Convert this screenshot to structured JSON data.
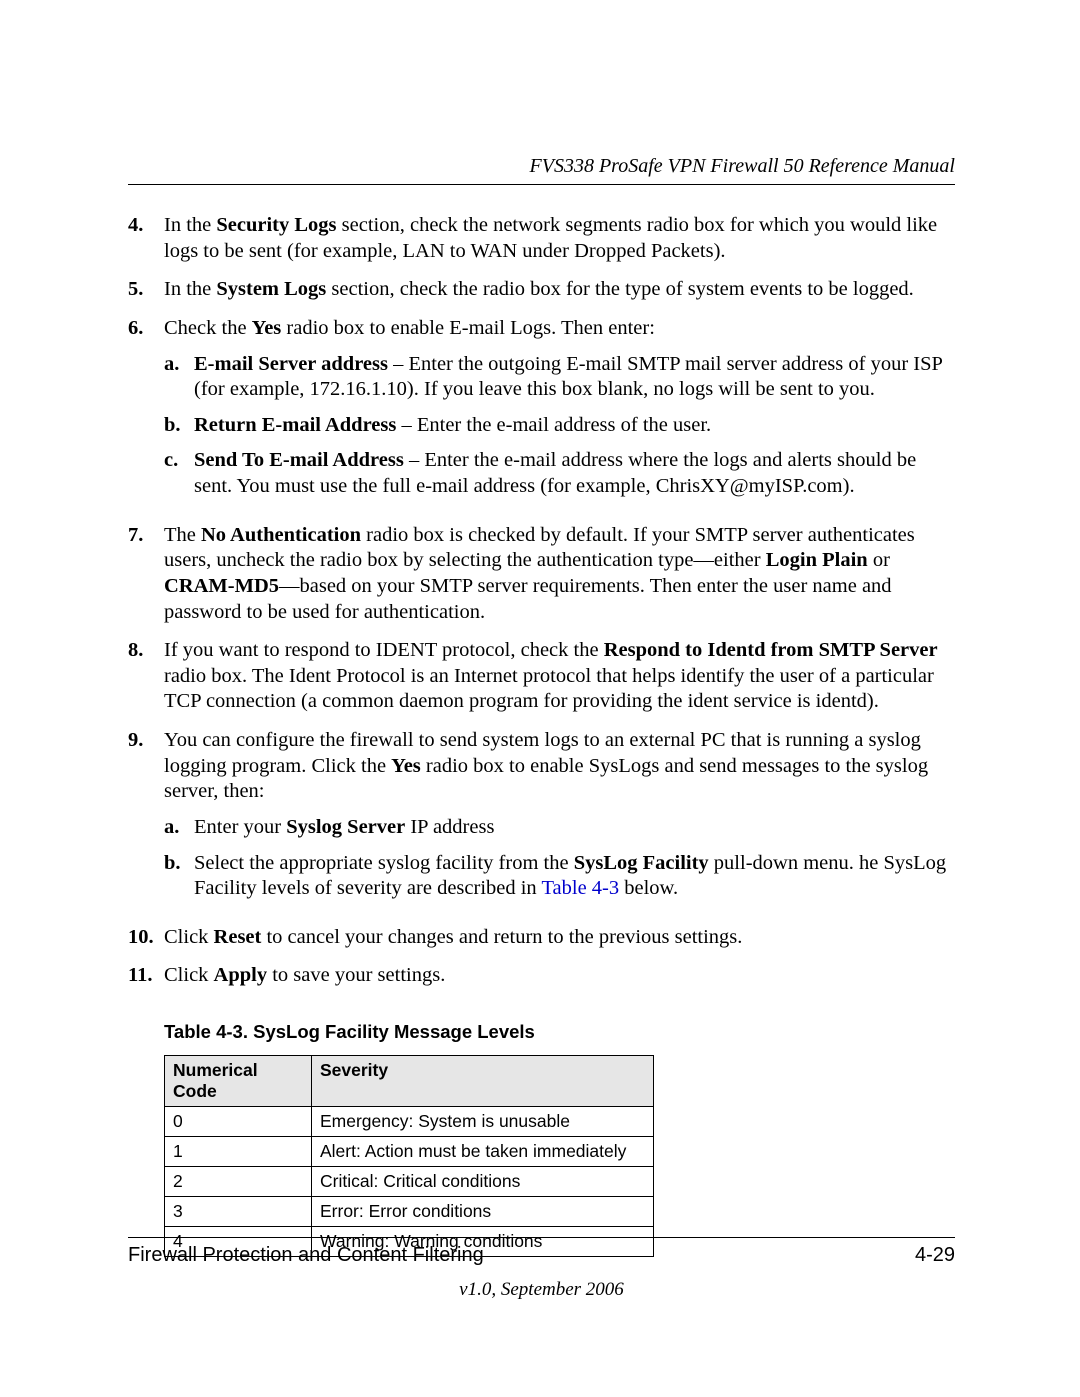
{
  "header": {
    "title": "FVS338 ProSafe VPN Firewall 50 Reference Manual"
  },
  "list": {
    "item4": {
      "num": "4.",
      "pre": "In the ",
      "bold": "Security Logs",
      "post": " section, check the network segments radio box for which you would like logs to be sent (for example, LAN to WAN under Dropped Packets)."
    },
    "item5": {
      "num": "5.",
      "pre": "In the ",
      "bold": "System Logs",
      "post": " section, check the radio box for the type of system events to be logged."
    },
    "item6": {
      "num": "6.",
      "pre": "Check the ",
      "bold": "Yes",
      "post": " radio box to enable E-mail Logs. Then enter:",
      "a": {
        "letter": "a.",
        "bold": "E-mail Server address",
        "text": " – Enter the outgoing E-mail SMTP mail server address of your ISP (for example, 172.16.1.10). If you leave this box blank, no logs will be sent to you."
      },
      "b": {
        "letter": "b.",
        "bold": "Return E-mail Address",
        "text": " – Enter the e-mail address of the user."
      },
      "c": {
        "letter": "c.",
        "bold": "Send To E-mail Address",
        "text": " – Enter the e-mail address where the logs and alerts should be sent. You must use the full e-mail address (for example, ChrisXY@myISP.com)."
      }
    },
    "item7": {
      "num": "7.",
      "t1": "The ",
      "b1": "No Authentication",
      "t2": " radio box is checked by default. If your SMTP server authenticates users, uncheck the radio box by selecting the authentication type—either ",
      "b2": "Login Plain",
      "t3": " or ",
      "b3": "CRAM-MD5",
      "t4": "—based on your SMTP server requirements. Then enter the user name and password to be used for authentication."
    },
    "item8": {
      "num": "8.",
      "t1": "If you want to respond to IDENT protocol, check the ",
      "b1": "Respond to Identd from SMTP Server",
      "t2": " radio box. The Ident Protocol is an Internet protocol that helps identify the user of a particular TCP connection (a common daemon program for providing the ident service is identd)."
    },
    "item9": {
      "num": "9.",
      "t1": "You can configure the firewall to send system logs to an external PC that is running a syslog logging program. Click the ",
      "b1": "Yes",
      "t2": " radio box to enable SysLogs and send messages to the syslog server, then:",
      "a": {
        "letter": "a.",
        "t1": "Enter your ",
        "b1": "Syslog Server",
        "t2": " IP address"
      },
      "b": {
        "letter": "b.",
        "t1": "Select the appropriate syslog facility from the ",
        "b1": "SysLog Facility",
        "t2": " pull-down menu. he SysLog Facility levels of severity are described in ",
        "link": "Table 4-3",
        "t3": " below."
      }
    },
    "item10": {
      "num": "10.",
      "t1": "Click ",
      "b1": "Reset",
      "t2": " to cancel your changes and return to the previous settings."
    },
    "item11": {
      "num": "11.",
      "t1": "Click ",
      "b1": "Apply",
      "t2": " to save your settings."
    }
  },
  "table": {
    "caption": "Table 4-3. SysLog Facility Message Levels",
    "headers": {
      "col1": "Numerical Code",
      "col2": "Severity"
    },
    "rows": [
      {
        "code": "0",
        "sev": "Emergency: System is unusable"
      },
      {
        "code": "1",
        "sev": "Alert: Action must be taken immediately"
      },
      {
        "code": "2",
        "sev": "Critical: Critical conditions"
      },
      {
        "code": "3",
        "sev": "Error: Error conditions"
      },
      {
        "code": "4",
        "sev": "Warning: Warning conditions"
      }
    ]
  },
  "footer": {
    "left": "Firewall Protection and Content Filtering",
    "right": "4-29",
    "version": "v1.0, September 2006"
  }
}
